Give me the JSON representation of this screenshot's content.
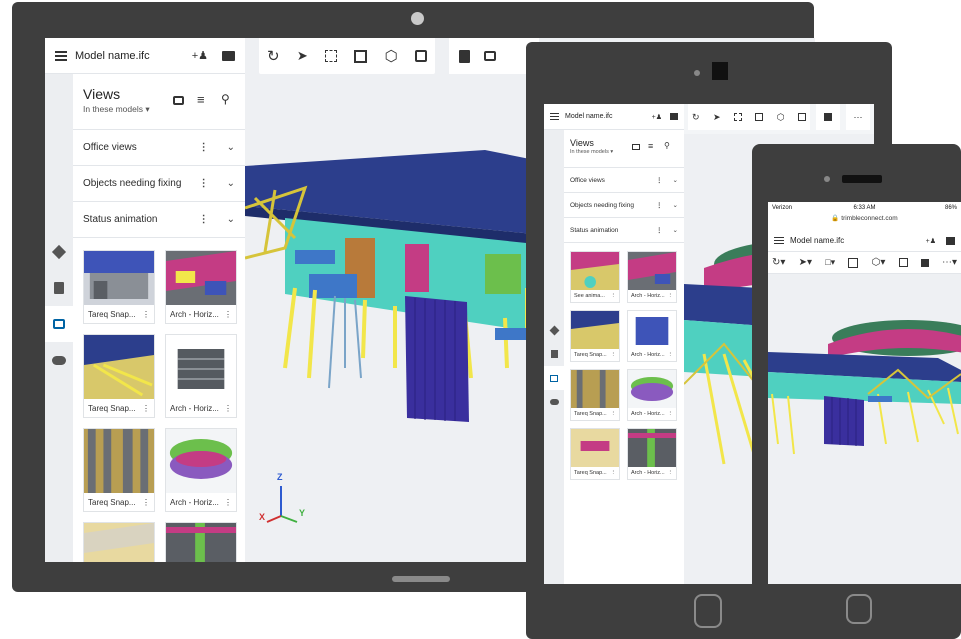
{
  "tablet_large": {
    "file_name": "Model name.ifc",
    "views_title": "Views",
    "views_subtitle": "In these models",
    "sections": [
      "Office views",
      "Objects needing fixing",
      "Status animation"
    ],
    "thumbnails": [
      "Tareq Snap...",
      "Arch - Horiz...",
      "Tareq Snap...",
      "Arch - Horiz...",
      "Tareq Snap...",
      "Arch - Horiz..."
    ],
    "axis": {
      "z": "Z",
      "x": "X",
      "y": "Y"
    }
  },
  "tablet_small": {
    "file_name": "Model name.ifc",
    "views_title": "Views",
    "views_subtitle": "In these models",
    "sections": [
      "Office views",
      "Objects needing fixing",
      "Status animation"
    ],
    "thumbnails": [
      "See anima...",
      "Arch - Horiz...",
      "Tareq Snap...",
      "Arch - Horiz...",
      "Tareq Snap...",
      "Arch - Horiz...",
      "Tareq Snap...",
      "Arch - Horiz..."
    ]
  },
  "phone": {
    "carrier": "Verizon",
    "time": "6:33 AM",
    "battery": "86%",
    "url": "trimbleconnect.com",
    "file_name": "Model name.ifc"
  },
  "icons": {
    "menu": "hamburger-icon",
    "share": "add-user-icon",
    "folder": "folder-icon",
    "orbit": "orbit-icon",
    "select": "pointer-icon",
    "box": "box-select-icon",
    "fit": "fit-view-icon",
    "cube": "cube-icon",
    "layers": "layers-icon",
    "snapshot": "camera-icon",
    "filter": "filter-icon",
    "search": "search-icon",
    "cloud": "cloud-icon",
    "check": "clipboard-check-icon"
  },
  "colors": {
    "accent": "#0063a3",
    "device": "#3e3e3e",
    "roof": "#2c3e8c",
    "cyan": "#4fd0c0",
    "yellow": "#f2e64a",
    "purple": "#3a2f9e"
  }
}
